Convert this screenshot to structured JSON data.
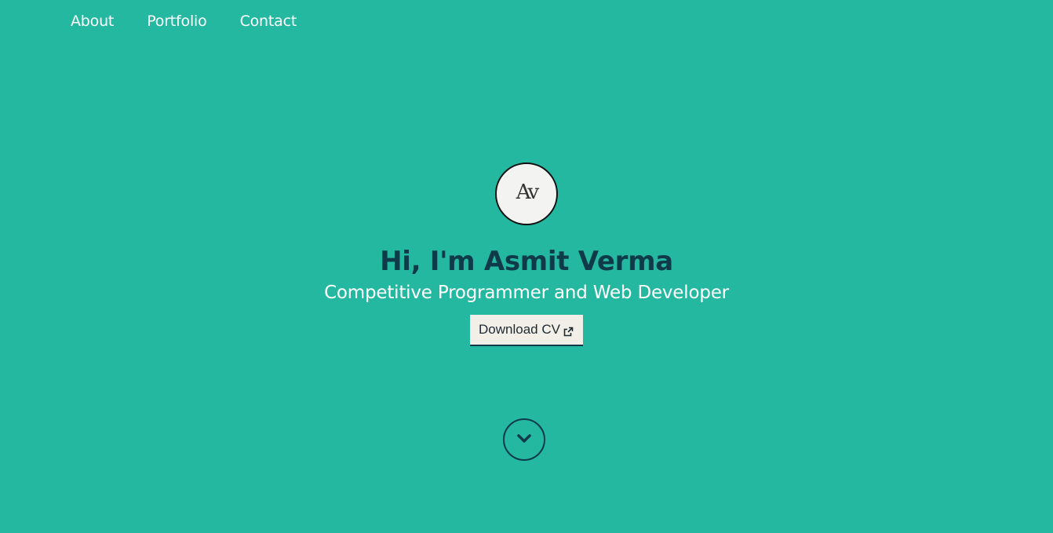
{
  "nav": {
    "items": [
      {
        "label": "About"
      },
      {
        "label": "Portfolio"
      },
      {
        "label": "Contact"
      }
    ]
  },
  "hero": {
    "avatar_monogram": "Av",
    "avatar_subtext": "Asmit Verma",
    "title": "Hi, I'm Asmit Verma",
    "subtitle": "Competitive Programmer and Web Developer",
    "cv_button_label": "Download CV",
    "cv_button_icon": "external-link-icon",
    "scroll_icon": "chevron-down-icon"
  },
  "colors": {
    "background": "#25b8a1",
    "heading": "#0f3a4a",
    "button_bg": "#f1efe7",
    "text_light": "#ffffff"
  }
}
